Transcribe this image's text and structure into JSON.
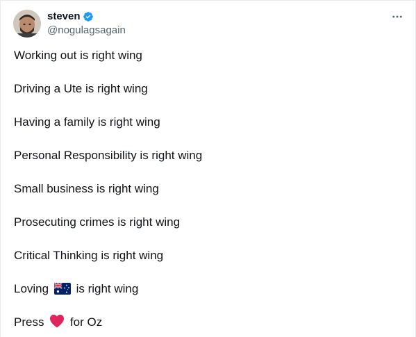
{
  "author": {
    "display_name": "steven",
    "handle": "@nogulagsagain",
    "verified": true
  },
  "icons": {
    "verified": "verified-badge-icon",
    "more": "more-horizontal-icon",
    "flag": "australia-flag-icon",
    "heart": "red-heart-icon"
  },
  "colors": {
    "verified_blue": "#1d9bf0",
    "secondary_text": "#536471",
    "heart_red": "#e0245e"
  },
  "tweet": {
    "lines": [
      "Working out is right wing",
      "Driving a Ute is right wing",
      "Having a family is right wing",
      "Personal Responsibility is right wing",
      "Small business is right wing",
      "Prosecuting crimes is right wing",
      "Critical Thinking is right wing"
    ],
    "flag_line": {
      "before": "Loving",
      "after": "is right wing"
    },
    "heart_line": {
      "before": "Press",
      "after": "for Oz"
    }
  }
}
